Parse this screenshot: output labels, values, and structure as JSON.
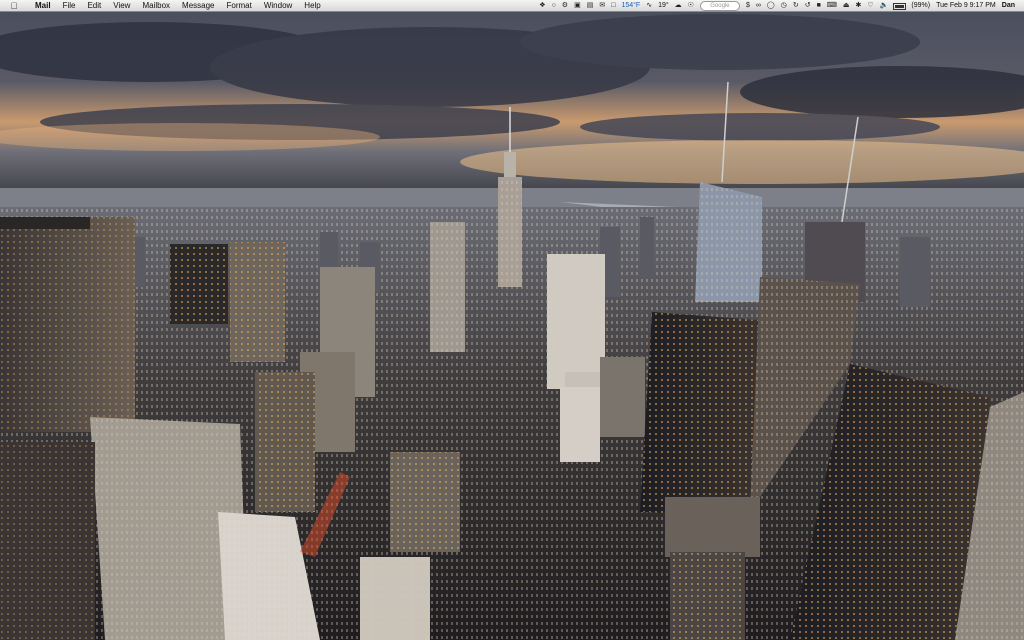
{
  "menubar": {
    "apple_icon": "apple-icon",
    "app_name": "Mail",
    "menus": [
      "File",
      "Edit",
      "View",
      "Mailbox",
      "Message",
      "Format",
      "Window",
      "Help"
    ],
    "temperature_cpu": "154°F",
    "temperature_weather": "19°",
    "search_placeholder": "Google",
    "battery_percent": "(99%)",
    "battery_level": 0.99,
    "clock": "Tue Feb 9  9:17 PM",
    "user": "Dan"
  },
  "wallpaper": {
    "sky_top": "#3a3f4e",
    "sky_glow": "#e8b57a",
    "city_dark": "#1e1e22"
  }
}
